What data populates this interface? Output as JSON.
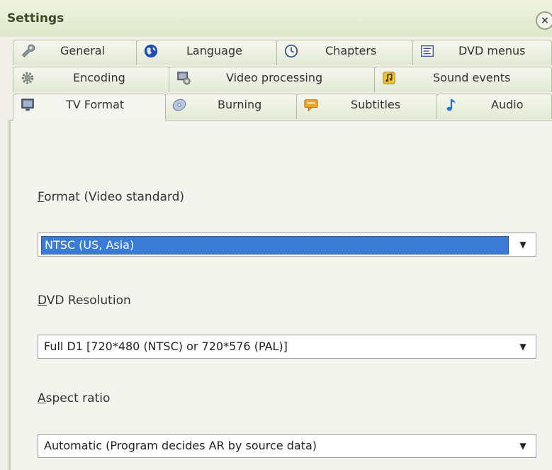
{
  "window": {
    "title": "Settings",
    "close_glyph": "×"
  },
  "tabs": {
    "row1": [
      {
        "label": "General",
        "icon": "wrench-icon"
      },
      {
        "label": "Language",
        "icon": "globe-icon"
      },
      {
        "label": "Chapters",
        "icon": "clock-icon"
      },
      {
        "label": "DVD menus",
        "icon": "menu-list-icon"
      }
    ],
    "row2": [
      {
        "label": "Encoding",
        "icon": "gear-icon"
      },
      {
        "label": "Video processing",
        "icon": "monitor-gear-icon"
      },
      {
        "label": "Sound events",
        "icon": "music-note-icon"
      }
    ],
    "row3": [
      {
        "label": "TV Format",
        "icon": "tv-icon",
        "active": true
      },
      {
        "label": "Burning",
        "icon": "disc-icon"
      },
      {
        "label": "Subtitles",
        "icon": "speech-bubble-icon"
      },
      {
        "label": "Audio",
        "icon": "note-icon"
      }
    ]
  },
  "fields": {
    "format": {
      "label_hotkey": "F",
      "label_rest": "ormat (Video standard)",
      "value": "NTSC (US, Asia)"
    },
    "resolution": {
      "label_hotkey": "D",
      "label_rest": "VD Resolution",
      "value": "Full D1 [720*480 (NTSC) or 720*576 (PAL)]"
    },
    "aspect": {
      "label_hotkey": "A",
      "label_rest": "spect ratio",
      "value": "Automatic (Program decides AR by source data)"
    }
  },
  "colors": {
    "selection": "#3a7bd5",
    "accent_green": "#3a4a27"
  }
}
